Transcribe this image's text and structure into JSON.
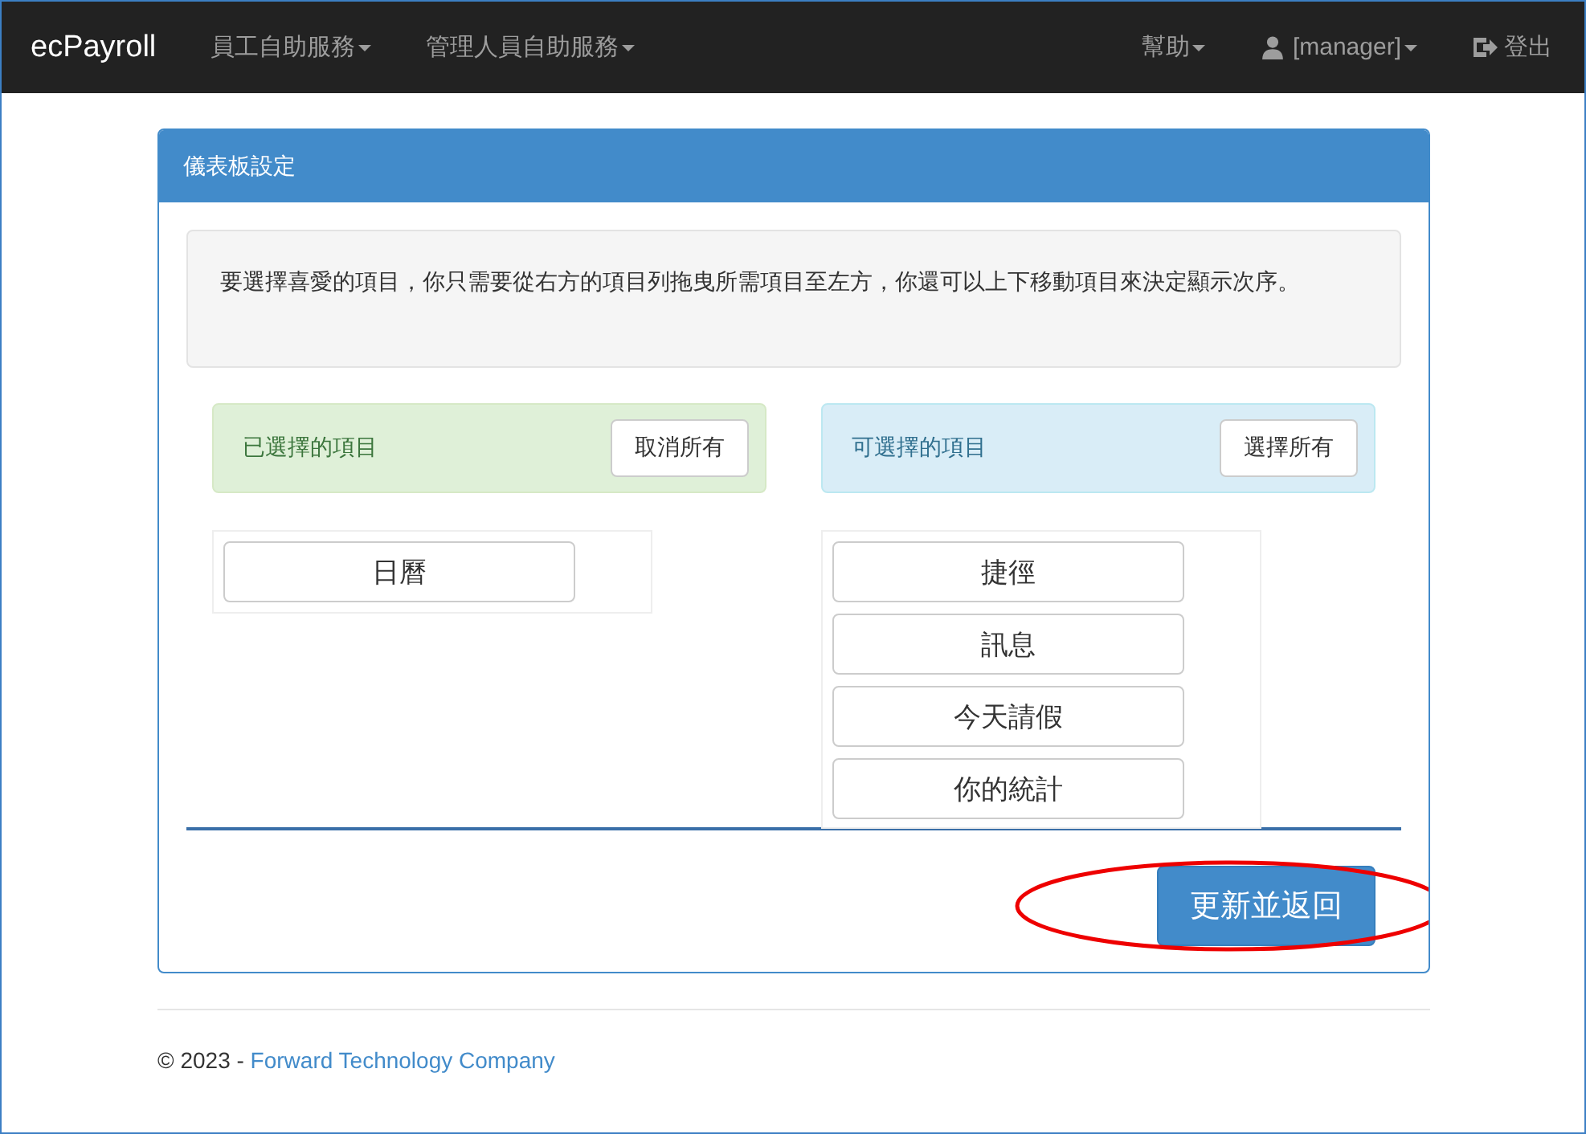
{
  "navbar": {
    "brand": "ecPayroll",
    "left_menu": [
      {
        "label": "員工自助服務",
        "dropdown": true
      },
      {
        "label": "管理人員自助服務",
        "dropdown": true
      }
    ],
    "right_menu": [
      {
        "label": "幫助",
        "kind": "dropdown"
      },
      {
        "label": "[manager]",
        "kind": "user"
      },
      {
        "label": "登出",
        "kind": "logout"
      }
    ]
  },
  "panel": {
    "title": "儀表板設定",
    "instructions": "要選擇喜愛的項目，你只需要從右方的項目列拖曳所需項目至左方，你還可以上下移動項目來決定顯示次序。",
    "selected_list": {
      "heading": "已選擇的項目",
      "button": "取消所有",
      "items": [
        "日曆"
      ]
    },
    "available_list": {
      "heading": "可選擇的項目",
      "button": "選擇所有",
      "items": [
        "捷徑",
        "訊息",
        "今天請假",
        "你的統計"
      ]
    },
    "submit_button": "更新並返回"
  },
  "footer": {
    "copyright": "© 2023 -",
    "link": "Forward Technology Company"
  }
}
